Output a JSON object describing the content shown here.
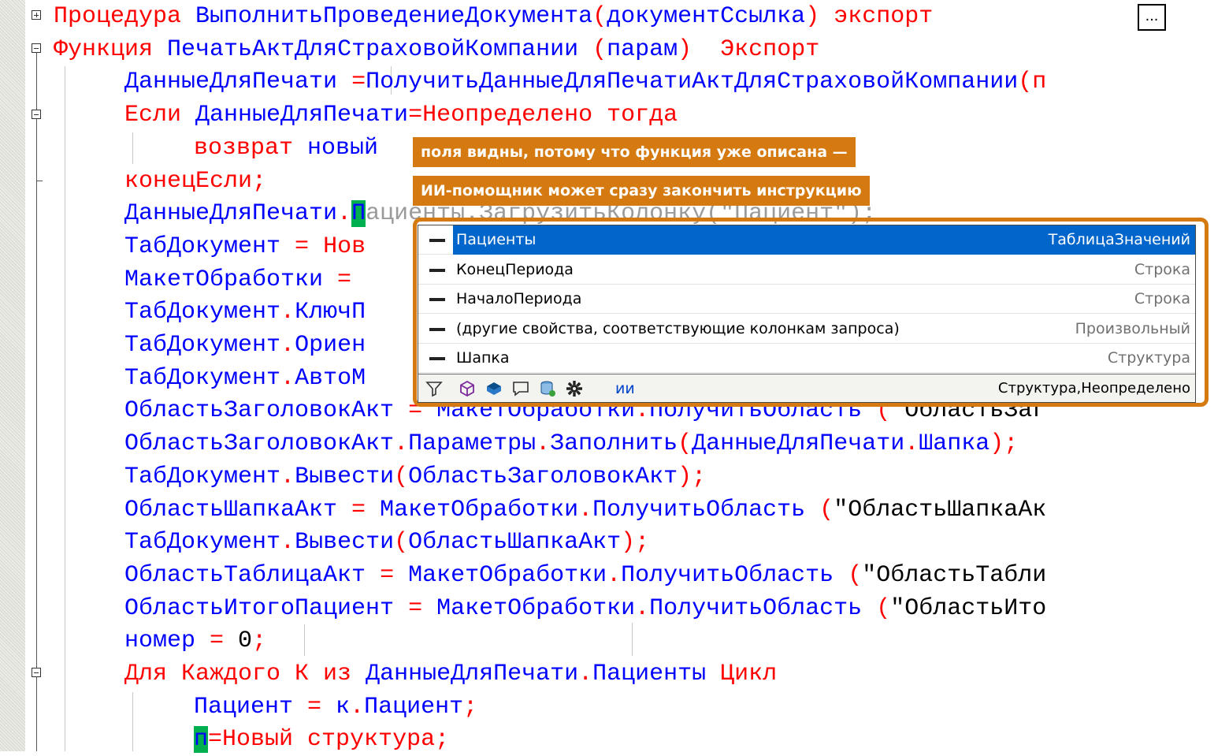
{
  "editor": {
    "lines": [
      {
        "parts": [
          {
            "t": "Процедура ",
            "c": "kw"
          },
          {
            "t": "ВыполнитьПроведениеДокумента",
            "c": ""
          },
          {
            "t": "(",
            "c": "op"
          },
          {
            "t": "документСсылка",
            "c": ""
          },
          {
            "t": ")",
            "c": "op"
          },
          {
            "t": " экспорт ",
            "c": "kw"
          }
        ]
      },
      {
        "parts": [
          {
            "t": "Функция ",
            "c": "kw"
          },
          {
            "t": "ПечатьАктДляСтраховойКомпании ",
            "c": ""
          },
          {
            "t": "(",
            "c": "op"
          },
          {
            "t": "парам",
            "c": ""
          },
          {
            "t": ")",
            "c": "op"
          },
          {
            "t": "  Экспорт",
            "c": "kw"
          }
        ]
      },
      {
        "parts": [
          {
            "t": "ДанныеДляПечати",
            "c": ""
          },
          {
            "t": " ",
            "c": ""
          },
          {
            "t": "=",
            "c": "op"
          },
          {
            "t": "ПолучитьДанныеДляПечатиАктДляСтраховойКомпании",
            "c": ""
          },
          {
            "t": "(п",
            "c": "op"
          }
        ]
      },
      {
        "parts": [
          {
            "t": "Если ",
            "c": "kw"
          },
          {
            "t": "ДанныеДляПечати",
            "c": ""
          },
          {
            "t": "=",
            "c": "op"
          },
          {
            "t": "Неопределено тогда",
            "c": "kw"
          }
        ]
      },
      {
        "parts": [
          {
            "t": "возврат ",
            "c": "kw"
          },
          {
            "t": "новый",
            "c": ""
          }
        ]
      },
      {
        "parts": [
          {
            "t": "конецЕсли",
            "c": "kw"
          },
          {
            "t": ";",
            "c": "op"
          }
        ]
      },
      {
        "parts": [
          {
            "t": "ДанныеДляПечати",
            "c": ""
          },
          {
            "t": ".",
            "c": "op"
          },
          {
            "t": "П",
            "c": "hl"
          },
          {
            "t": "ациенты.ЗагрузитьКолонку(\"Пациент\");",
            "c": "ghost"
          }
        ]
      },
      {
        "parts": [
          {
            "t": "ТабДокумент ",
            "c": ""
          },
          {
            "t": "= ",
            "c": "op"
          },
          {
            "t": "Нов",
            "c": "kw"
          }
        ]
      },
      {
        "parts": [
          {
            "t": "МакетОбработки ",
            "c": ""
          },
          {
            "t": "=",
            "c": "op"
          }
        ]
      },
      {
        "parts": [
          {
            "t": "ТабДокумент",
            "c": ""
          },
          {
            "t": ".",
            "c": "op"
          },
          {
            "t": "КлючП",
            "c": ""
          }
        ]
      },
      {
        "parts": [
          {
            "t": "ТабДокумент",
            "c": ""
          },
          {
            "t": ".",
            "c": "op"
          },
          {
            "t": "Ориен",
            "c": ""
          }
        ]
      },
      {
        "parts": [
          {
            "t": "ТабДокумент",
            "c": ""
          },
          {
            "t": ".",
            "c": "op"
          },
          {
            "t": "АвтоМ",
            "c": ""
          }
        ]
      },
      {
        "parts": [
          {
            "t": "ОбластьЗаголовокАкт ",
            "c": ""
          },
          {
            "t": "= ",
            "c": "op"
          },
          {
            "t": "МакетОбработки",
            "c": ""
          },
          {
            "t": ".",
            "c": "op"
          },
          {
            "t": "ПолучитьОбласть ",
            "c": ""
          },
          {
            "t": "(",
            "c": "op"
          },
          {
            "t": "\"ОбластьЗаг",
            "c": "str"
          }
        ]
      },
      {
        "parts": [
          {
            "t": "ОбластьЗаголовокАкт",
            "c": ""
          },
          {
            "t": ".",
            "c": "op"
          },
          {
            "t": "Параметры",
            "c": ""
          },
          {
            "t": ".",
            "c": "op"
          },
          {
            "t": "Заполнить",
            "c": ""
          },
          {
            "t": "(",
            "c": "op"
          },
          {
            "t": "ДанныеДляПечати",
            "c": ""
          },
          {
            "t": ".",
            "c": "op"
          },
          {
            "t": "Шапка",
            "c": ""
          },
          {
            "t": ");",
            "c": "op"
          }
        ]
      },
      {
        "parts": [
          {
            "t": "ТабДокумент",
            "c": ""
          },
          {
            "t": ".",
            "c": "op"
          },
          {
            "t": "Вывести",
            "c": ""
          },
          {
            "t": "(",
            "c": "op"
          },
          {
            "t": "ОбластьЗаголовокАкт",
            "c": ""
          },
          {
            "t": ");",
            "c": "op"
          }
        ]
      },
      {
        "parts": [
          {
            "t": "ОбластьШапкаАкт ",
            "c": ""
          },
          {
            "t": "= ",
            "c": "op"
          },
          {
            "t": "МакетОбработки",
            "c": ""
          },
          {
            "t": ".",
            "c": "op"
          },
          {
            "t": "ПолучитьОбласть ",
            "c": ""
          },
          {
            "t": "(",
            "c": "op"
          },
          {
            "t": "\"ОбластьШапкаАк",
            "c": "str"
          }
        ]
      },
      {
        "parts": [
          {
            "t": "ТабДокумент",
            "c": ""
          },
          {
            "t": ".",
            "c": "op"
          },
          {
            "t": "Вывести",
            "c": ""
          },
          {
            "t": "(",
            "c": "op"
          },
          {
            "t": "ОбластьШапкаАкт",
            "c": ""
          },
          {
            "t": ");",
            "c": "op"
          }
        ]
      },
      {
        "parts": [
          {
            "t": "ОбластьТаблицаАкт ",
            "c": ""
          },
          {
            "t": "= ",
            "c": "op"
          },
          {
            "t": "МакетОбработки",
            "c": ""
          },
          {
            "t": ".",
            "c": "op"
          },
          {
            "t": "ПолучитьОбласть ",
            "c": ""
          },
          {
            "t": "(",
            "c": "op"
          },
          {
            "t": "\"ОбластьТабли",
            "c": "str"
          }
        ]
      },
      {
        "parts": [
          {
            "t": "ОбластьИтогоПациент ",
            "c": ""
          },
          {
            "t": "= ",
            "c": "op"
          },
          {
            "t": "МакетОбработки",
            "c": ""
          },
          {
            "t": ".",
            "c": "op"
          },
          {
            "t": "ПолучитьОбласть ",
            "c": ""
          },
          {
            "t": "(",
            "c": "op"
          },
          {
            "t": "\"ОбластьИто",
            "c": "str"
          }
        ]
      },
      {
        "parts": [
          {
            "t": "номер ",
            "c": ""
          },
          {
            "t": "= ",
            "c": "op"
          },
          {
            "t": "0",
            "c": "num"
          },
          {
            "t": ";",
            "c": "op"
          }
        ]
      },
      {
        "parts": [
          {
            "t": "Для Каждого К из ",
            "c": "kw"
          },
          {
            "t": "ДанныеДляПечати",
            "c": ""
          },
          {
            "t": ".",
            "c": "op"
          },
          {
            "t": "Пациенты ",
            "c": ""
          },
          {
            "t": "Цикл",
            "c": "kw"
          }
        ]
      },
      {
        "parts": [
          {
            "t": "Пациент ",
            "c": ""
          },
          {
            "t": "= ",
            "c": "op"
          },
          {
            "t": "к",
            "c": ""
          },
          {
            "t": ".",
            "c": "op"
          },
          {
            "t": "Пациент",
            "c": ""
          },
          {
            "t": ";",
            "c": "op"
          }
        ]
      },
      {
        "parts": [
          {
            "t": "п",
            "c": "hl"
          },
          {
            "t": "=",
            "c": "op"
          },
          {
            "t": "Новый структура",
            "c": "kw"
          },
          {
            "t": ";",
            "c": "op"
          }
        ]
      }
    ],
    "ellipsis_label": "..."
  },
  "callouts": {
    "first": "поля видны, потому что функция уже описана —",
    "second": "ИИ-помощник может сразу закончить инструкцию"
  },
  "autocomplete": {
    "items": [
      {
        "name": "Пациенты",
        "type": "ТаблицаЗначений",
        "selected": true
      },
      {
        "name": "КонецПериода",
        "type": "Строка",
        "selected": false
      },
      {
        "name": "НачалоПериода",
        "type": "Строка",
        "selected": false
      },
      {
        "name": "(другие свойства, соответствующие колонкам запроса)",
        "type": "Произвольный",
        "selected": false
      },
      {
        "name": "Шапка",
        "type": "Структура",
        "selected": false
      }
    ],
    "status": {
      "icons": [
        "filter-icon",
        "cube-icon",
        "box-icon",
        "comment-icon",
        "database-icon",
        "gear-icon"
      ],
      "ai_label": "ии",
      "info": "Структура,Неопределено"
    }
  },
  "colors": {
    "keyword": "#ff0000",
    "identifier": "#0000ff",
    "accent": "#d47a10",
    "selection": "#0066cc",
    "cursor": "#00b050"
  }
}
